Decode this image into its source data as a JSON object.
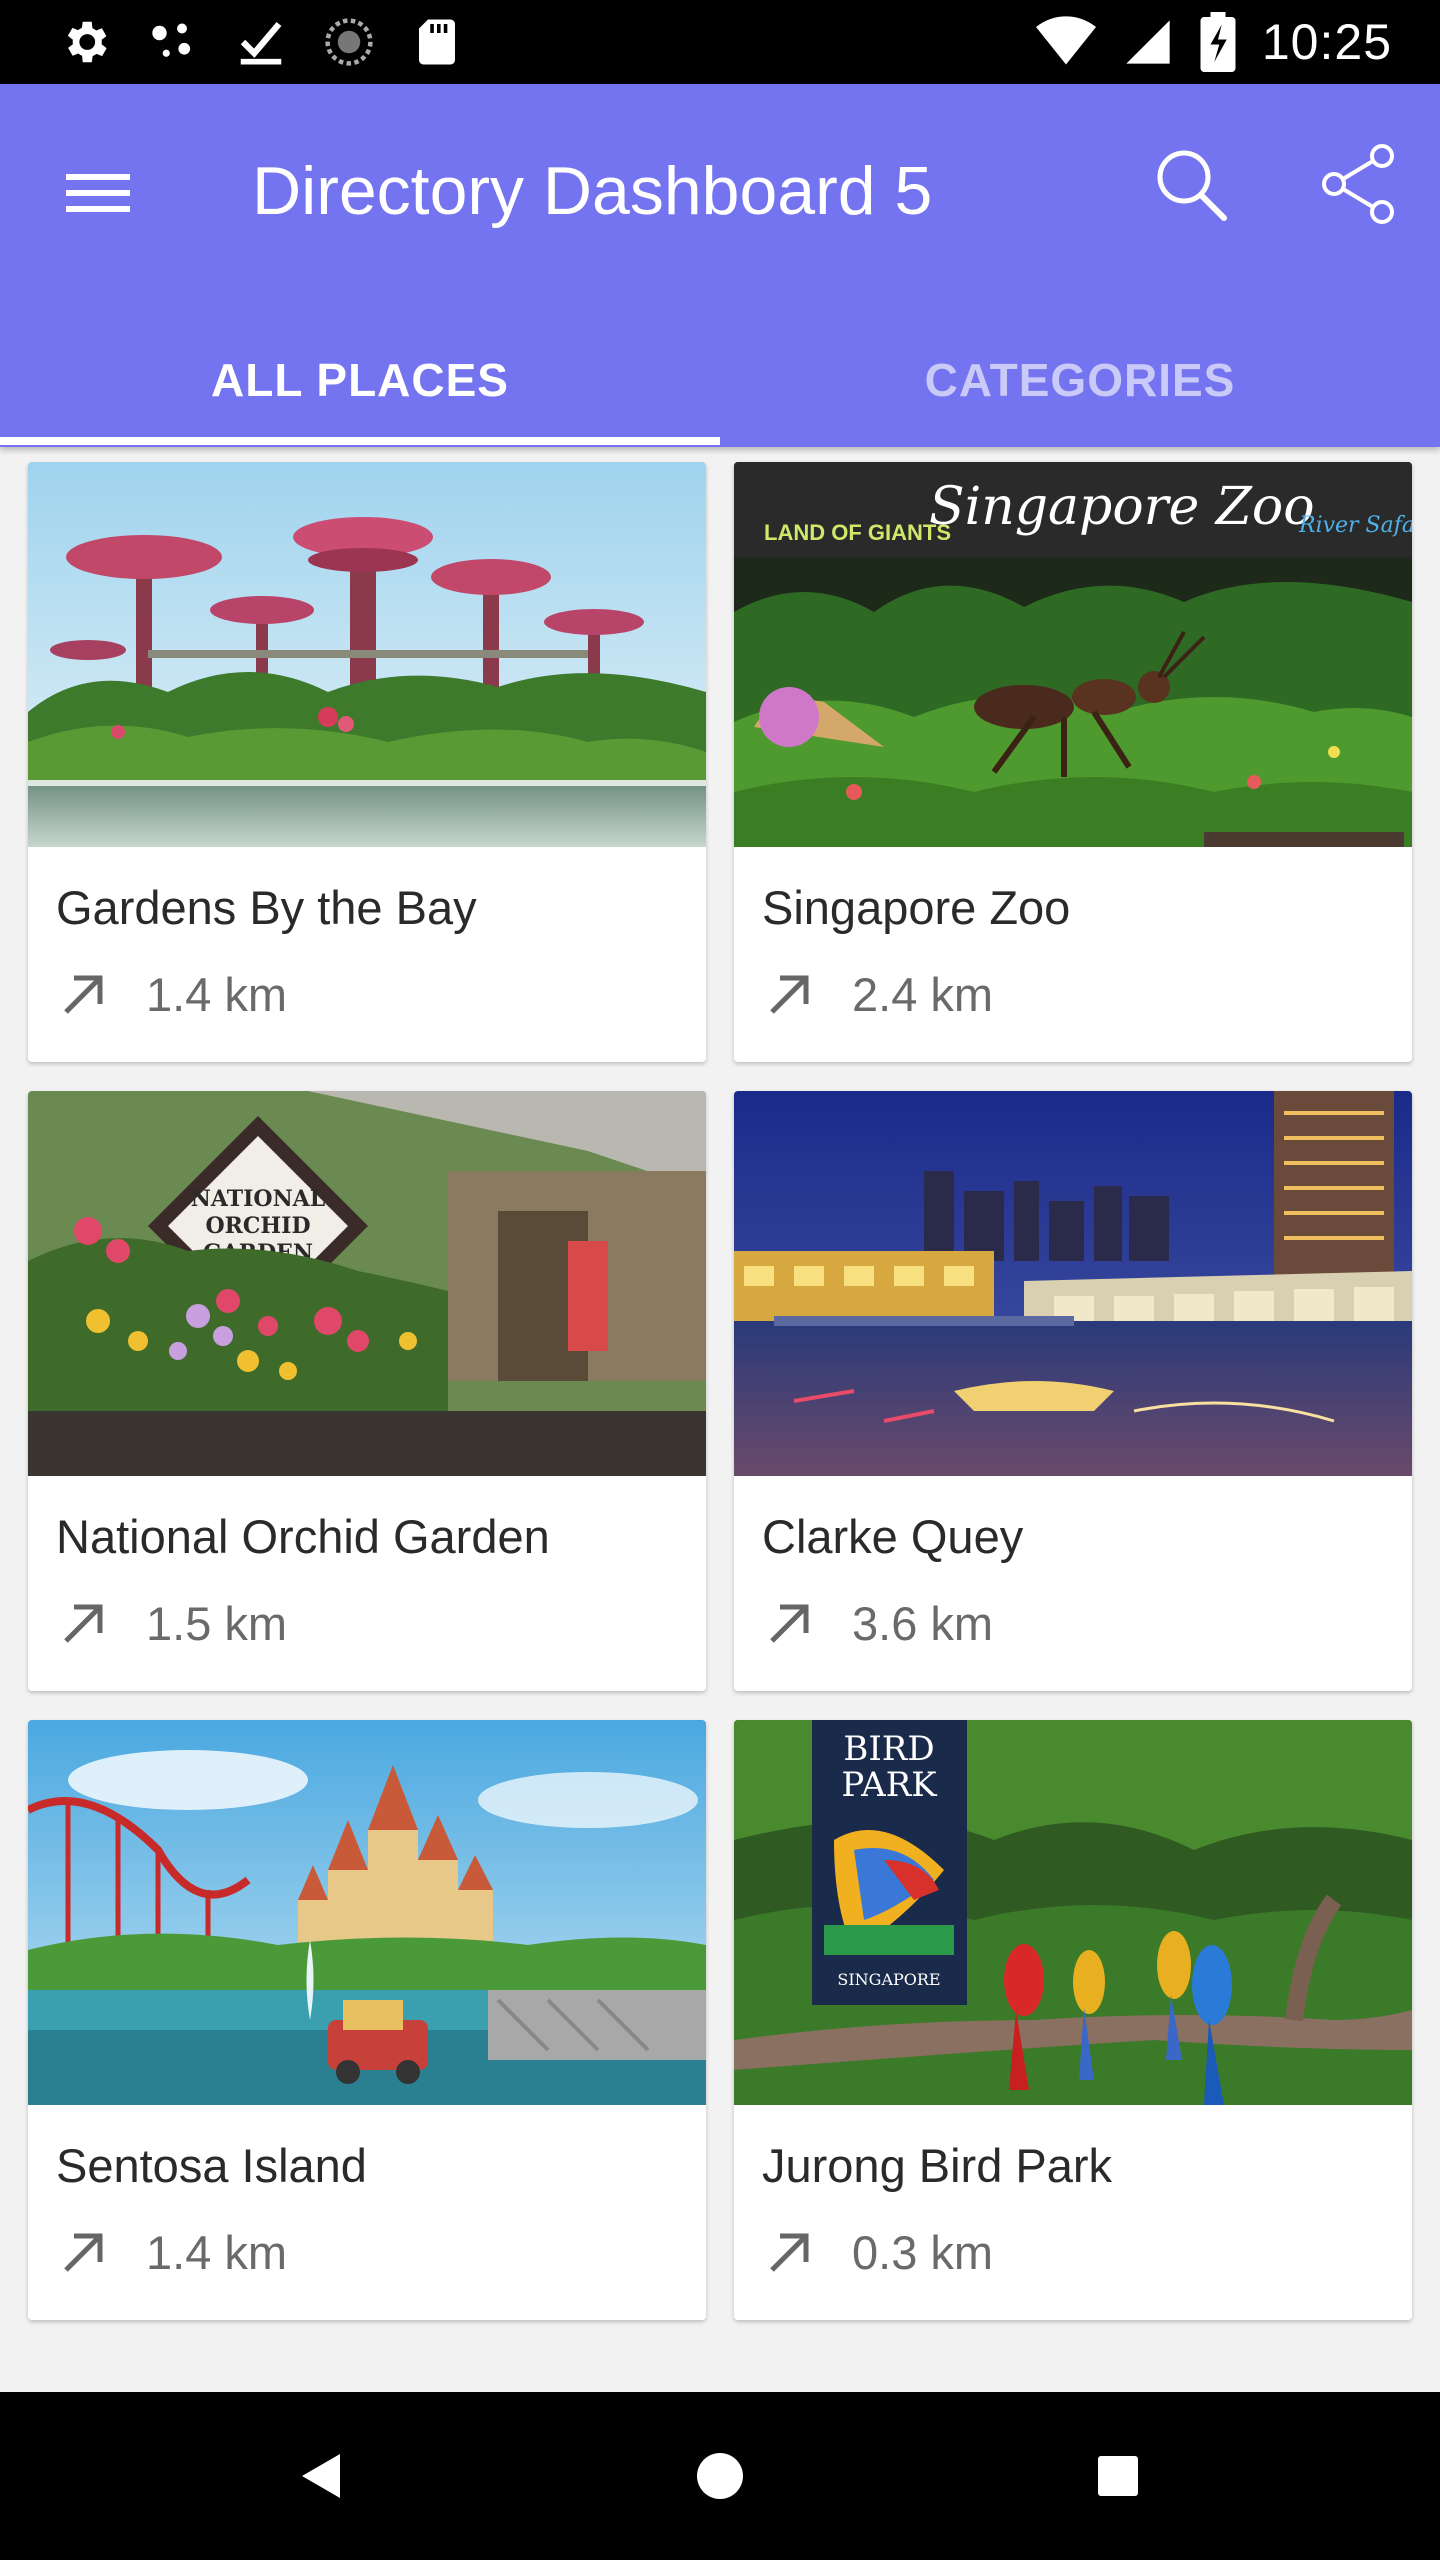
{
  "status_bar": {
    "time": "10:25",
    "icons_left": [
      "settings-icon",
      "dots-icon",
      "download-done-icon",
      "sync-icon",
      "sd-card-icon"
    ],
    "icons_right": [
      "wifi-icon",
      "signal-icon",
      "battery-charging-icon"
    ]
  },
  "app_bar": {
    "title": "Directory Dashboard 5",
    "color": "#7474f0",
    "menu_icon": "menu-icon",
    "search_icon": "search-icon",
    "share_icon": "share-icon"
  },
  "tabs": [
    {
      "label": "ALL PLACES",
      "selected": true
    },
    {
      "label": "CATEGORIES",
      "selected": false
    }
  ],
  "places": [
    {
      "name": "Gardens By the Bay",
      "distance": "1.4 km",
      "image": "supertree-grove-photo"
    },
    {
      "name": "Singapore Zoo",
      "distance": "2.4 km",
      "image": "singapore-zoo-entrance-photo"
    },
    {
      "name": "National Orchid Garden",
      "distance": "1.5 km",
      "image": "orchid-garden-entrance-photo"
    },
    {
      "name": "Clarke Quey",
      "distance": "3.6 km",
      "image": "clarke-quay-night-photo"
    },
    {
      "name": "Sentosa Island",
      "distance": "1.4 km",
      "image": "sentosa-castle-photo"
    },
    {
      "name": "Jurong Bird Park",
      "distance": "0.3 km",
      "image": "bird-park-macaws-photo"
    }
  ],
  "image_text": {
    "zoo_sign": "Singapore Zoo",
    "zoo_land": "LAND OF GIANTS",
    "zoo_river": "River Safari",
    "orchid_sign_1": "NATIONAL",
    "orchid_sign_2": "ORCHID",
    "orchid_sign_3": "GARDEN",
    "bird_sign_1": "BIRD",
    "bird_sign_2": "PARK",
    "bird_sign_3": "SINGAPORE"
  },
  "nav_bar": {
    "back_icon": "back-triangle-icon",
    "home_icon": "home-circle-icon",
    "recents_icon": "recents-square-icon"
  }
}
